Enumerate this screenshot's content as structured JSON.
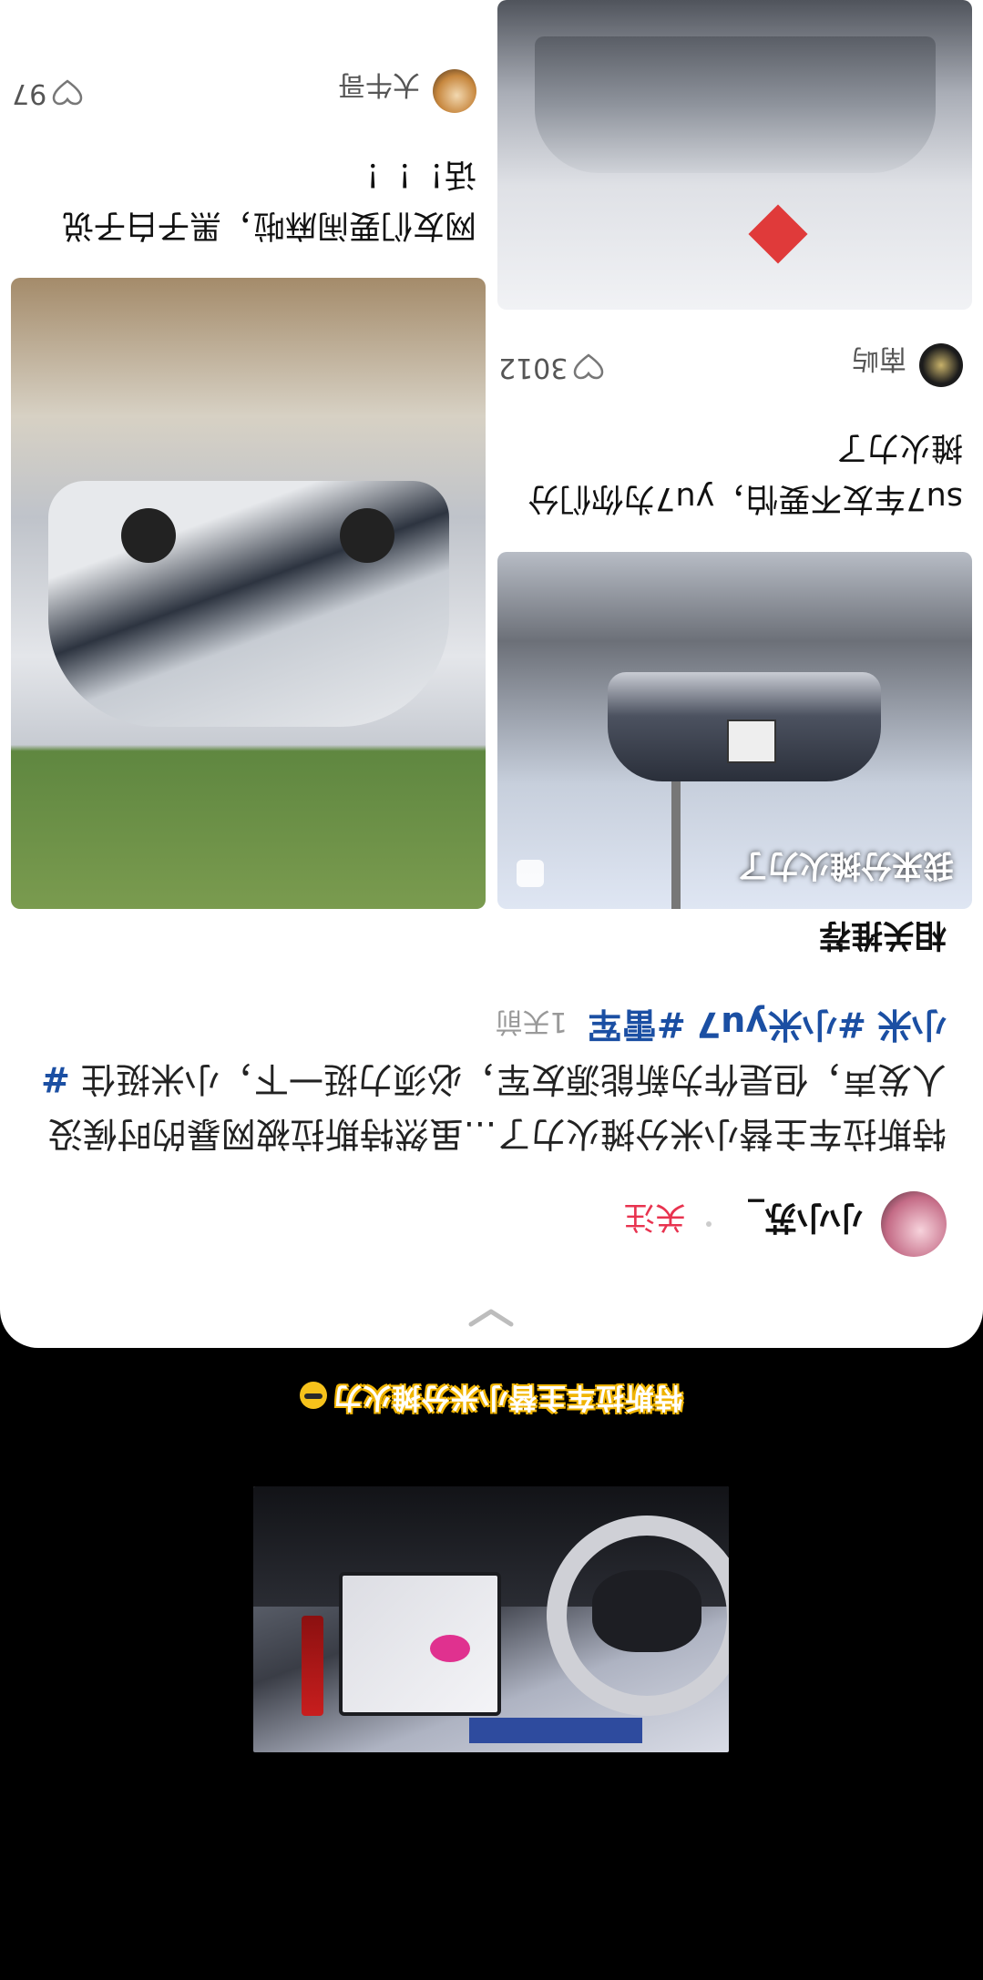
{
  "video": {
    "subtitle": "特斯拉车主替小米分摊火力"
  },
  "post": {
    "author": "小小苏_",
    "follow_label": "关注",
    "text": "特斯拉车主替小米分摊火力了...虽然特斯拉被网暴的时候没人发声，但是作为新能源友军，必须力挺一下，小米挺住",
    "tags": [
      "#小米",
      "#小米yu7",
      "#雷军"
    ],
    "time": "1天前"
  },
  "related": {
    "title": "相关推荐",
    "cards": [
      {
        "image_overlay": "我来分摊火力了",
        "title": "su7车友不要怕，yu7为你们分摊火力了",
        "author": "南屿",
        "likes": "3012"
      },
      {
        "title": "网友们要闹麻啦，黑子白子说话！！！",
        "author": "大牛哥",
        "likes": "97"
      }
    ]
  },
  "colors": {
    "accent": "#e8334f",
    "tag": "#1b4fa3",
    "background": "#000000",
    "sheet": "#ffffff"
  },
  "icons": [
    "chevron-down-icon",
    "heart-icon",
    "copy-icon"
  ]
}
